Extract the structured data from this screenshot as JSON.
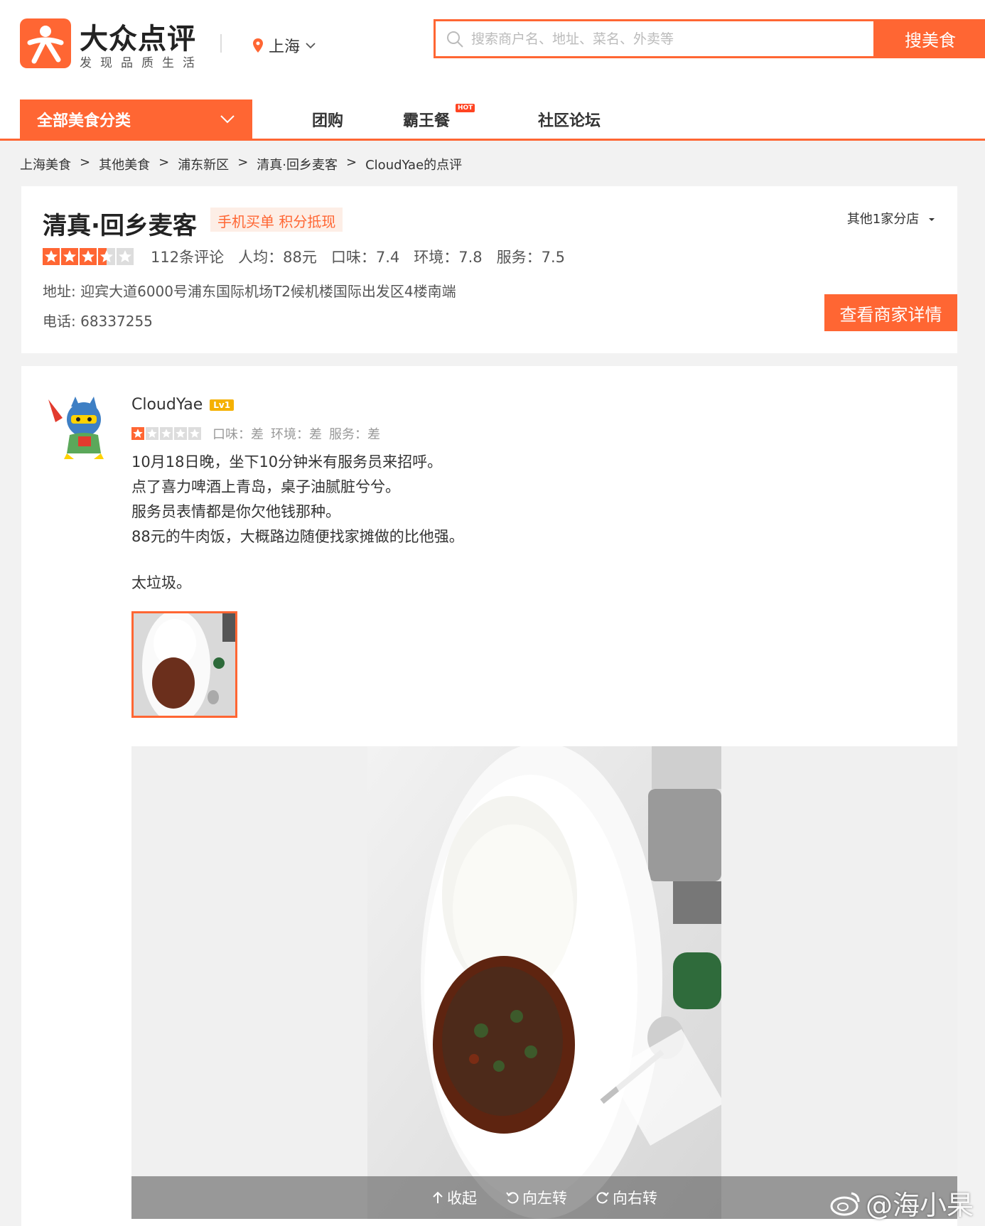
{
  "header": {
    "brand_name": "大众点评",
    "brand_slogan": "发现品质生活",
    "city": "上海",
    "search_placeholder": "搜索商户名、地址、菜名、外卖等",
    "search_button": "搜美食",
    "accent_color": "#ff6633"
  },
  "nav": {
    "category_label": "全部美食分类",
    "items": [
      {
        "label": "团购"
      },
      {
        "label": "霸王餐",
        "badge": "HOT"
      },
      {
        "label": "社区论坛"
      }
    ]
  },
  "breadcrumb": [
    "上海美食",
    "其他美食",
    "浦东新区",
    "清真·回乡麦客",
    "CloudYae的点评"
  ],
  "shop": {
    "name": "清真·回乡麦客",
    "tag": "手机买单 积分抵现",
    "branches": "其他1家分店",
    "rating_stars": 3.5,
    "reviews": "112条评论",
    "avg_price": "人均：88元",
    "taste": "口味：7.4",
    "environment": "环境：7.8",
    "service": "服务：7.5",
    "address": "地址: 迎宾大道6000号浦东国际机场T2候机楼国际出发区4楼南端",
    "phone": "电话: 68337255",
    "detail_button": "查看商家详情"
  },
  "review": {
    "username": "CloudYae",
    "level": "Lv1",
    "rating_stars": 1,
    "scores": [
      "口味：差",
      "环境：差",
      "服务：差"
    ],
    "lines": [
      "10月18日晚，坐下10分钟米有服务员来招呼。",
      "点了喜力啤酒上青岛，桌子油腻脏兮兮。",
      "服务员表情都是你欠他钱那种。",
      "88元的牛肉饭，大概路边随便找家摊做的比他强。"
    ],
    "closing": "太垃圾。",
    "toolbar": {
      "collapse": "收起",
      "rotate_left": "向左转",
      "rotate_right": "向右转"
    }
  },
  "watermark": "@海小杲"
}
